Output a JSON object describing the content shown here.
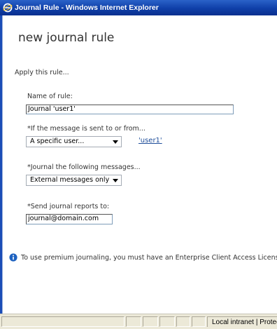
{
  "window": {
    "title": "Journal Rule - Windows Internet Explorer"
  },
  "page": {
    "heading": "new journal rule",
    "apply_text": "Apply this rule...",
    "rule_name": {
      "label": "Name of rule:",
      "value": "Journal 'user1'"
    },
    "condition": {
      "label": "*If the message is sent to or from...",
      "selected": "A specific user...",
      "link": "'user1'"
    },
    "scope": {
      "label": "*Journal the following messages...",
      "selected": "External messages only"
    },
    "recipient": {
      "label": "*Send journal reports to:",
      "value": "journal@domain.com"
    },
    "info_text": "To use premium journaling, you must have an Enterprise Client Access License"
  },
  "statusbar": {
    "zone_text": "Local intranet | Protected Mode: Off"
  },
  "colors": {
    "titlebar": "#0f3fa8",
    "link": "#1f4e9a",
    "info_icon": "#1e62c0"
  },
  "icons": {
    "titlebar": "internet-explorer-icon",
    "info": "info-icon",
    "zone": "local-intranet-icon",
    "dropdown": "chevron-down-icon"
  }
}
